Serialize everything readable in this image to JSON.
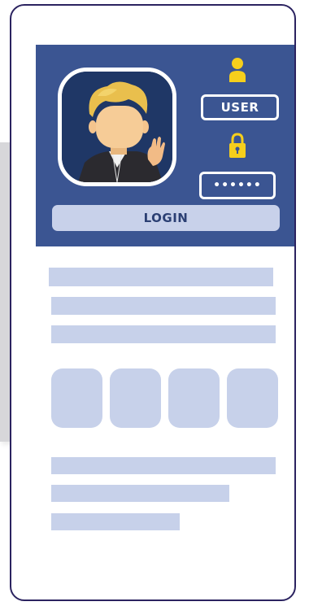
{
  "login_card": {
    "user_label": "USER",
    "password_mask": "••••••",
    "login_label": "LOGIN"
  },
  "icons": {
    "user": "user-icon",
    "lock": "lock-icon",
    "avatar": "avatar-illustration"
  },
  "colors": {
    "card_background": "#3b5592",
    "accent_yellow": "#f6cf1c",
    "placeholder": "#c7d1ea",
    "phone_outline": "#2b2360"
  }
}
